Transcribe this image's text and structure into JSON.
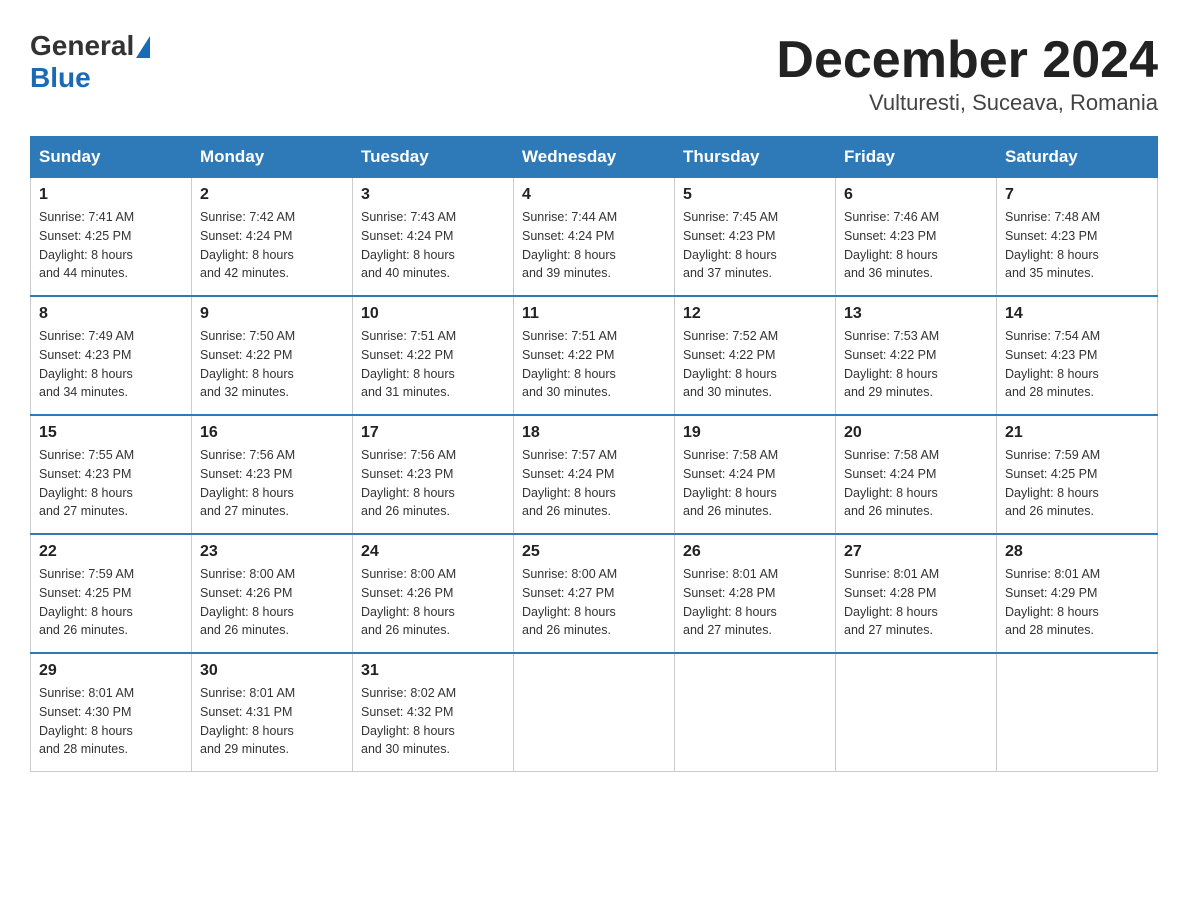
{
  "header": {
    "title": "December 2024",
    "subtitle": "Vulturesti, Suceava, Romania"
  },
  "logo": {
    "general": "General",
    "blue": "Blue"
  },
  "days": [
    "Sunday",
    "Monday",
    "Tuesday",
    "Wednesday",
    "Thursday",
    "Friday",
    "Saturday"
  ],
  "weeks": [
    [
      {
        "num": "1",
        "info": "Sunrise: 7:41 AM\nSunset: 4:25 PM\nDaylight: 8 hours\nand 44 minutes."
      },
      {
        "num": "2",
        "info": "Sunrise: 7:42 AM\nSunset: 4:24 PM\nDaylight: 8 hours\nand 42 minutes."
      },
      {
        "num": "3",
        "info": "Sunrise: 7:43 AM\nSunset: 4:24 PM\nDaylight: 8 hours\nand 40 minutes."
      },
      {
        "num": "4",
        "info": "Sunrise: 7:44 AM\nSunset: 4:24 PM\nDaylight: 8 hours\nand 39 minutes."
      },
      {
        "num": "5",
        "info": "Sunrise: 7:45 AM\nSunset: 4:23 PM\nDaylight: 8 hours\nand 37 minutes."
      },
      {
        "num": "6",
        "info": "Sunrise: 7:46 AM\nSunset: 4:23 PM\nDaylight: 8 hours\nand 36 minutes."
      },
      {
        "num": "7",
        "info": "Sunrise: 7:48 AM\nSunset: 4:23 PM\nDaylight: 8 hours\nand 35 minutes."
      }
    ],
    [
      {
        "num": "8",
        "info": "Sunrise: 7:49 AM\nSunset: 4:23 PM\nDaylight: 8 hours\nand 34 minutes."
      },
      {
        "num": "9",
        "info": "Sunrise: 7:50 AM\nSunset: 4:22 PM\nDaylight: 8 hours\nand 32 minutes."
      },
      {
        "num": "10",
        "info": "Sunrise: 7:51 AM\nSunset: 4:22 PM\nDaylight: 8 hours\nand 31 minutes."
      },
      {
        "num": "11",
        "info": "Sunrise: 7:51 AM\nSunset: 4:22 PM\nDaylight: 8 hours\nand 30 minutes."
      },
      {
        "num": "12",
        "info": "Sunrise: 7:52 AM\nSunset: 4:22 PM\nDaylight: 8 hours\nand 30 minutes."
      },
      {
        "num": "13",
        "info": "Sunrise: 7:53 AM\nSunset: 4:22 PM\nDaylight: 8 hours\nand 29 minutes."
      },
      {
        "num": "14",
        "info": "Sunrise: 7:54 AM\nSunset: 4:23 PM\nDaylight: 8 hours\nand 28 minutes."
      }
    ],
    [
      {
        "num": "15",
        "info": "Sunrise: 7:55 AM\nSunset: 4:23 PM\nDaylight: 8 hours\nand 27 minutes."
      },
      {
        "num": "16",
        "info": "Sunrise: 7:56 AM\nSunset: 4:23 PM\nDaylight: 8 hours\nand 27 minutes."
      },
      {
        "num": "17",
        "info": "Sunrise: 7:56 AM\nSunset: 4:23 PM\nDaylight: 8 hours\nand 26 minutes."
      },
      {
        "num": "18",
        "info": "Sunrise: 7:57 AM\nSunset: 4:24 PM\nDaylight: 8 hours\nand 26 minutes."
      },
      {
        "num": "19",
        "info": "Sunrise: 7:58 AM\nSunset: 4:24 PM\nDaylight: 8 hours\nand 26 minutes."
      },
      {
        "num": "20",
        "info": "Sunrise: 7:58 AM\nSunset: 4:24 PM\nDaylight: 8 hours\nand 26 minutes."
      },
      {
        "num": "21",
        "info": "Sunrise: 7:59 AM\nSunset: 4:25 PM\nDaylight: 8 hours\nand 26 minutes."
      }
    ],
    [
      {
        "num": "22",
        "info": "Sunrise: 7:59 AM\nSunset: 4:25 PM\nDaylight: 8 hours\nand 26 minutes."
      },
      {
        "num": "23",
        "info": "Sunrise: 8:00 AM\nSunset: 4:26 PM\nDaylight: 8 hours\nand 26 minutes."
      },
      {
        "num": "24",
        "info": "Sunrise: 8:00 AM\nSunset: 4:26 PM\nDaylight: 8 hours\nand 26 minutes."
      },
      {
        "num": "25",
        "info": "Sunrise: 8:00 AM\nSunset: 4:27 PM\nDaylight: 8 hours\nand 26 minutes."
      },
      {
        "num": "26",
        "info": "Sunrise: 8:01 AM\nSunset: 4:28 PM\nDaylight: 8 hours\nand 27 minutes."
      },
      {
        "num": "27",
        "info": "Sunrise: 8:01 AM\nSunset: 4:28 PM\nDaylight: 8 hours\nand 27 minutes."
      },
      {
        "num": "28",
        "info": "Sunrise: 8:01 AM\nSunset: 4:29 PM\nDaylight: 8 hours\nand 28 minutes."
      }
    ],
    [
      {
        "num": "29",
        "info": "Sunrise: 8:01 AM\nSunset: 4:30 PM\nDaylight: 8 hours\nand 28 minutes."
      },
      {
        "num": "30",
        "info": "Sunrise: 8:01 AM\nSunset: 4:31 PM\nDaylight: 8 hours\nand 29 minutes."
      },
      {
        "num": "31",
        "info": "Sunrise: 8:02 AM\nSunset: 4:32 PM\nDaylight: 8 hours\nand 30 minutes."
      },
      {
        "num": "",
        "info": ""
      },
      {
        "num": "",
        "info": ""
      },
      {
        "num": "",
        "info": ""
      },
      {
        "num": "",
        "info": ""
      }
    ]
  ]
}
